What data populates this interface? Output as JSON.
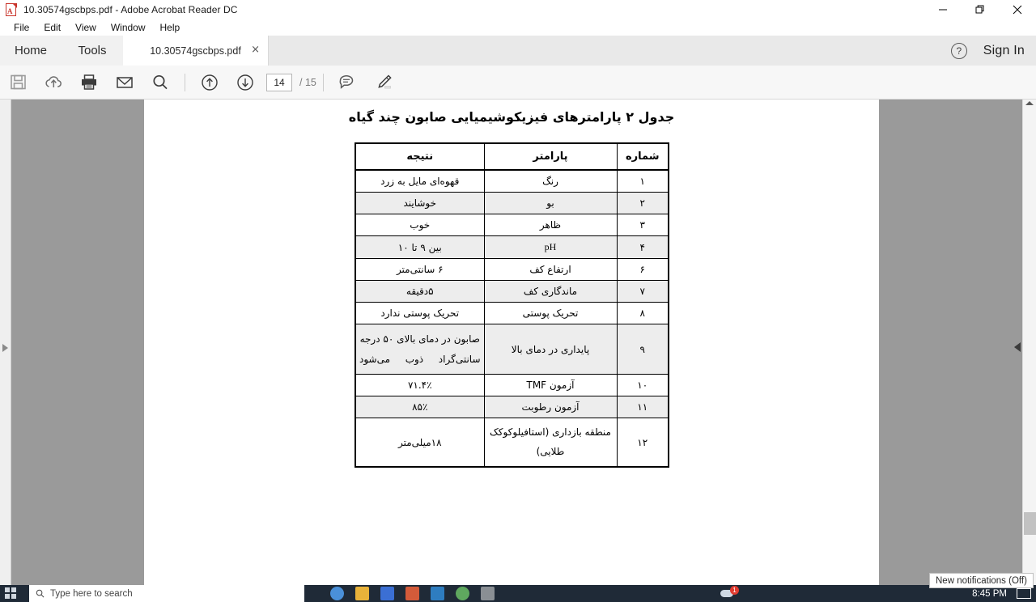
{
  "window": {
    "title": "10.30574gscbps.pdf - Adobe Acrobat Reader DC",
    "app_icon": "pdf-file-icon",
    "controls": {
      "minimize": "minimize-icon",
      "restore": "restore-icon",
      "close": "close-icon"
    }
  },
  "menubar": {
    "items": [
      "File",
      "Edit",
      "View",
      "Window",
      "Help"
    ]
  },
  "tabs": {
    "home_label": "Home",
    "tools_label": "Tools",
    "document_tab_label": "10.30574gscbps.pdf",
    "close_glyph": "×",
    "help_glyph": "?",
    "sign_in_label": "Sign In"
  },
  "toolbar": {
    "buttons": [
      {
        "name": "save-icon",
        "title": "Save"
      },
      {
        "name": "upload-cloud-icon",
        "title": "Save to cloud"
      },
      {
        "name": "print-icon",
        "title": "Print"
      },
      {
        "name": "email-icon",
        "title": "Send by email"
      },
      {
        "name": "search-icon",
        "title": "Find"
      }
    ],
    "prev_page": "previous-page-icon",
    "next_page": "next-page-icon",
    "page_value": "14",
    "page_total": "/ 15",
    "comment_icon": "comment-bubble-icon",
    "highlight_icon": "highlighter-pen-icon"
  },
  "document": {
    "title": "جدول ۲ پارامترهای فیزیکوشیمیایی صابون چند گیاه",
    "table": {
      "headers": [
        "شماره",
        "پارامتر",
        "نتیجه"
      ],
      "rows": [
        {
          "num": "۱",
          "param": "رنگ",
          "result": "قهوه‌ای مایل به زرد"
        },
        {
          "num": "۲",
          "param": "بو",
          "result": "خوشایند"
        },
        {
          "num": "۳",
          "param": "ظاهر",
          "result": "خوب"
        },
        {
          "num": "۴",
          "param": "pH",
          "result": "بین ۹ تا ۱۰"
        },
        {
          "num": "۶",
          "param": "ارتفاع کف",
          "result": "۶ سانتی‌متر"
        },
        {
          "num": "۷",
          "param": "ماندگاری کف",
          "result": "۵دقیقه"
        },
        {
          "num": "۸",
          "param": "تحریک پوستی",
          "result": "تحریک پوستی ندارد"
        },
        {
          "num": "۹",
          "param": "پایداری در دمای بالا",
          "result": "صابون در دمای بالای ۵۰ درجه سانتی‌گراد ذوب می‌شود"
        },
        {
          "num": "۱۰",
          "param": "آزمون TMF",
          "result": "۷۱.۴٪"
        },
        {
          "num": "۱۱",
          "param": "آزمون رطوبت",
          "result": "۸۵٪"
        },
        {
          "num": "۱۲",
          "param": "منطقه بازداری (استافیلوکوکک طلایی)",
          "result": "۱۸میلی‌متر"
        }
      ]
    }
  },
  "viewer": {
    "left_rail_toggle": "expand-panel-icon",
    "scroll_up": "scroll-up-icon",
    "view_collapse": "collapse-panel-icon"
  },
  "taskbar": {
    "tooltip": "New notifications (Off)",
    "search_placeholder": "Type here to search",
    "clock": "8:45 PM",
    "notification_count": "1"
  },
  "colors": {
    "accent_red": "#c9352c",
    "toolbar_bg": "#f7f7f7",
    "viewer_bg": "#9a9a9a",
    "taskbar_bg": "#1f2a37",
    "table_alt_row": "#ededed"
  }
}
